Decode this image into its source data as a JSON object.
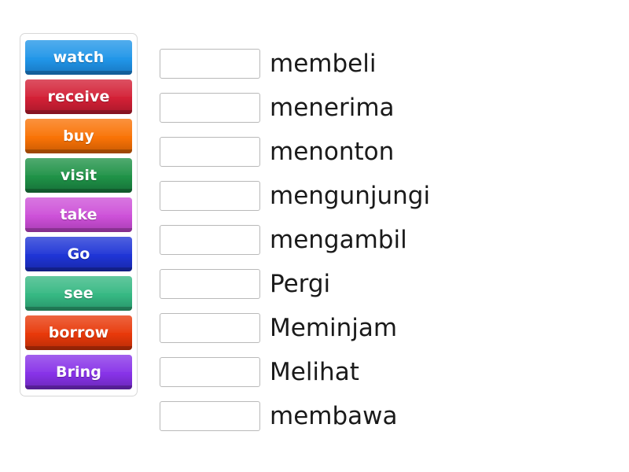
{
  "activity": {
    "type": "matching-drag-and-drop",
    "background_color": "#ffffff"
  },
  "tile_panel": {
    "border_color": "#d7d7d7",
    "tiles": [
      {
        "label": "watch",
        "color": "#2196e8",
        "shade": "#1877c2"
      },
      {
        "label": "receive",
        "color": "#d32036",
        "shade": "#a9182a"
      },
      {
        "label": "buy",
        "color": "#f97306",
        "shade": "#c85a03"
      },
      {
        "label": "visit",
        "color": "#1f9247",
        "shade": "#167038"
      },
      {
        "label": "take",
        "color": "#cd51d8",
        "shade": "#a93cb4"
      },
      {
        "label": "Go",
        "color": "#1f35d6",
        "shade": "#1727a8"
      },
      {
        "label": "see",
        "color": "#36b883",
        "shade": "#289468"
      },
      {
        "label": "borrow",
        "color": "#e8390a",
        "shade": "#b82c07"
      },
      {
        "label": "Bring",
        "color": "#8833e8",
        "shade": "#6a26b8"
      }
    ]
  },
  "answers": {
    "input_value": "",
    "input_placeholder": "",
    "rows": [
      {
        "word": "membeli"
      },
      {
        "word": "menerima"
      },
      {
        "word": "menonton"
      },
      {
        "word": "mengunjungi"
      },
      {
        "word": "mengambil"
      },
      {
        "word": "Pergi"
      },
      {
        "word": "Meminjam"
      },
      {
        "word": "Melihat"
      },
      {
        "word": "membawa"
      }
    ]
  }
}
